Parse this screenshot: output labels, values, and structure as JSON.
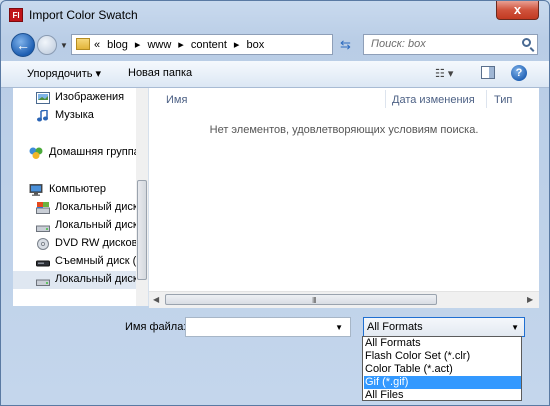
{
  "window": {
    "title": "Import Color Swatch",
    "app_icon_text": "Fl",
    "close_glyph": "x"
  },
  "nav": {
    "breadcrumb": [
      "«",
      "blog",
      "▸",
      "www",
      "▸",
      "content",
      "▸",
      "box"
    ],
    "search_placeholder": "Поиск: box"
  },
  "toolbar": {
    "organize_label": "Упорядочить ▾",
    "new_folder_label": "Новая папка",
    "view_glyph": "☷ ▾",
    "help_glyph": "?"
  },
  "sidebar": {
    "items": [
      {
        "label": "Изображения",
        "icon": "pictures-icon"
      },
      {
        "label": "Музыка",
        "icon": "music-icon"
      },
      {
        "label": "Домашняя группа",
        "icon": "homegroup-icon"
      },
      {
        "label": "Компьютер",
        "icon": "computer-icon"
      },
      {
        "label": "Локальный диск",
        "icon": "local-disk-icon"
      },
      {
        "label": "Локальный диск",
        "icon": "local-disk-icon"
      },
      {
        "label": "DVD RW дисково",
        "icon": "dvd-drive-icon"
      },
      {
        "label": "Съемный диск (",
        "icon": "removable-disk-icon"
      },
      {
        "label": "Локальный диск",
        "icon": "local-disk-icon",
        "selected": true
      }
    ]
  },
  "main": {
    "columns": [
      "Имя",
      "Дата изменения",
      "Тип"
    ],
    "empty_message": "Нет элементов, удовлетворяющих условиям поиска.",
    "grip_text": "III"
  },
  "bottom": {
    "filename_label": "Имя файла:",
    "filename_value": "",
    "filter_selected": "All Formats",
    "filter_options": [
      {
        "label": "All Formats"
      },
      {
        "label": "Flash Color Set (*.clr)"
      },
      {
        "label": "Color Table (*.act)"
      },
      {
        "label": "Gif  (*.gif)",
        "highlighted": true
      },
      {
        "label": "All Files"
      }
    ]
  },
  "colors": {
    "accent": "#1f6fd1",
    "highlight": "#3399ff",
    "close_button": "#c23a22"
  }
}
